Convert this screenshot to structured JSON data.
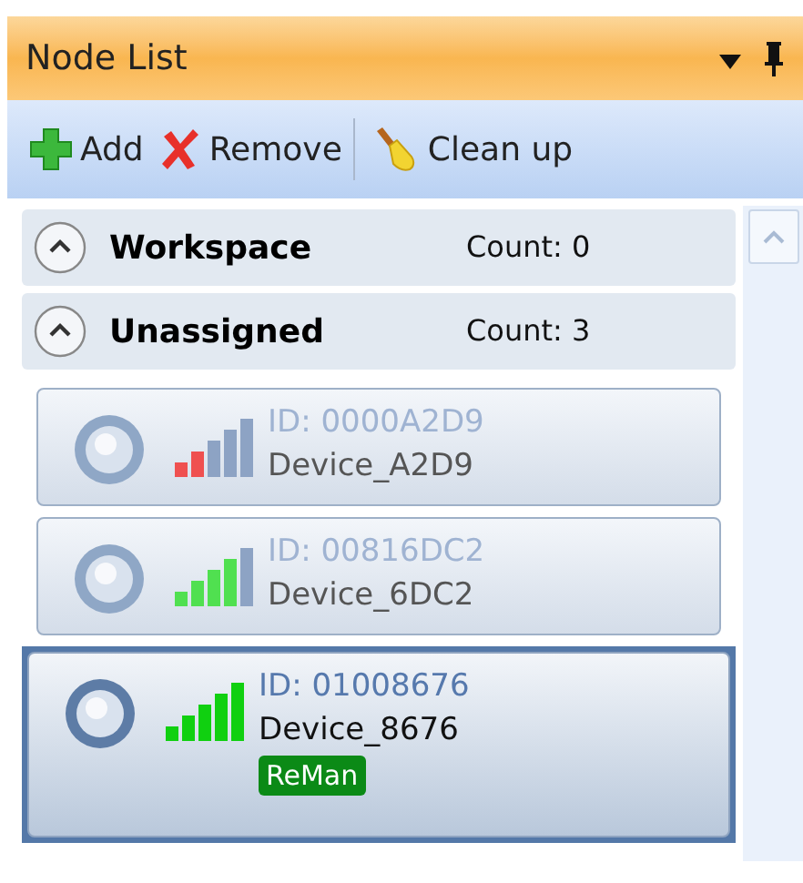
{
  "panel": {
    "title": "Node List"
  },
  "toolbar": [
    {
      "kind": "add",
      "label": "Add"
    },
    {
      "kind": "remove",
      "label": "Remove"
    },
    {
      "kind": "cleanup",
      "label": "Clean up"
    }
  ],
  "groups": [
    {
      "name": "Workspace",
      "count": "Count: 0",
      "expanded": true
    },
    {
      "name": "Unassigned",
      "count": "Count: 3",
      "expanded": true,
      "nodes": [
        {
          "id": "ID: 0000A2D9",
          "name": "Device_A2D9",
          "kind": "weak",
          "selected": false
        },
        {
          "id": "ID: 00816DC2",
          "name": "Device_6DC2",
          "kind": "good",
          "selected": false
        },
        {
          "id": "ID: 01008676",
          "name": "Device_8676",
          "kind": "full",
          "selected": true,
          "tag": "ReMan"
        }
      ]
    }
  ]
}
